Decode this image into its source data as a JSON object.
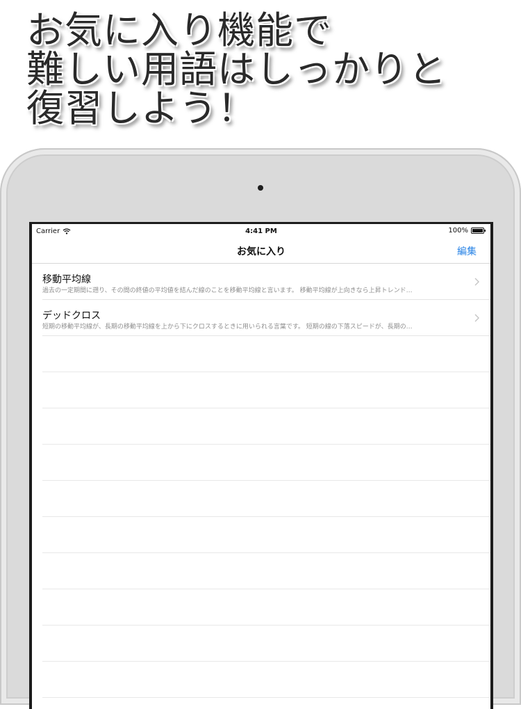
{
  "headline": {
    "lines": [
      "お気に入り機能で",
      "難しい用語はしっかりと",
      "復習しよう！"
    ]
  },
  "status_bar": {
    "carrier": "Carrier",
    "time": "4:41 PM",
    "battery": "100%"
  },
  "nav": {
    "title": "お気に入り",
    "edit_label": "編集"
  },
  "favorites": [
    {
      "title": "移動平均線",
      "subtitle": "過去の一定期間に遡り、その間の終値の平均値を結んだ線のことを移動平均線と言います。 移動平均線が上向きなら上昇トレンド…"
    },
    {
      "title": "デッドクロス",
      "subtitle": "短期の移動平均線が、長期の移動平均線を上から下にクロスするときに用いられる言葉です。 短期の線の下落スピードが、長期の…"
    }
  ],
  "colors": {
    "accent": "#2a84e6",
    "bezel": "#dadada"
  },
  "icons": {
    "wifi": "wifi-icon",
    "battery": "battery-icon",
    "chevron": "chevron-right-icon"
  }
}
